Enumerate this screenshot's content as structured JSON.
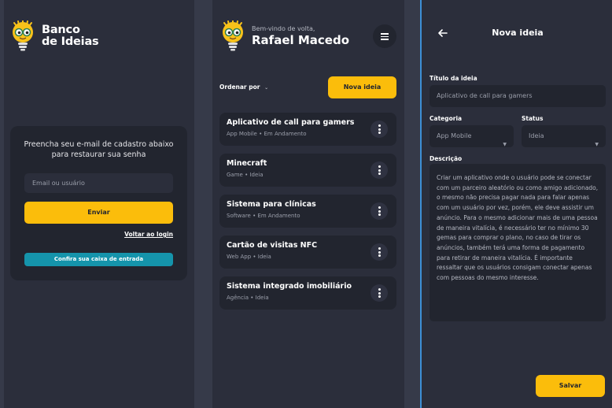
{
  "colors": {
    "background": "#363a49",
    "panel": "#2b2e3b",
    "card": "#22252f",
    "accent": "#fbbd0b",
    "teal": "#1594ab",
    "divider": "#3d8fd6"
  },
  "brand": {
    "line1": "Banco",
    "line2": "de Ideias",
    "logo_icon": "lightbulb-mascot-icon"
  },
  "recover": {
    "message": "Preencha seu e-mail de cadastro abaixo para restaurar sua senha",
    "email_placeholder": "Email ou usuário",
    "send_label": "Enviar",
    "back_to_login": "Voltar ao login",
    "check_inbox": "Confira sua caixa de entrada"
  },
  "home": {
    "welcome": "Bem-vindo de volta,",
    "username": "Rafael Macedo",
    "sort_label": "Ordenar por",
    "new_idea": "Nova ideia",
    "ideas": [
      {
        "title": "Aplicativo de call para gamers",
        "category": "App Mobile",
        "status": "Em Andamento"
      },
      {
        "title": "Minecraft",
        "category": "Game",
        "status": "Ideia"
      },
      {
        "title": "Sistema para clínicas",
        "category": "Software",
        "status": "Em Andamento"
      },
      {
        "title": "Cartão de visitas NFC",
        "category": "Web App",
        "status": "Ideia"
      },
      {
        "title": "Sistema integrado imobiliário",
        "category": "Agência",
        "status": "Ideia"
      }
    ],
    "separator": "•"
  },
  "form": {
    "header": "Nova ideia",
    "title_label": "Título da ideia",
    "title_value": "Aplicativo de call para gamers",
    "category_label": "Categoria",
    "category_value": "App Mobile",
    "status_label": "Status",
    "status_value": "Ideia",
    "description_label": "Descrição",
    "description_value": "Criar um aplicativo onde o usuário pode se conectar com um parceiro aleatório ou como amigo adicionado, o mesmo não precisa pagar nada para falar apenas com um usuário por vez, porém, ele deve assistir um anúncio. Para o mesmo adicionar mais de uma pessoa de maneira vitalícia, é necessário ter no mínimo 30 gemas para comprar o plano, no caso de tirar os anúncios, também terá uma forma de pagamento para retirar de maneira vitalícia. É importante ressaltar que os usuários consigam conectar apenas com pessoas do mesmo interesse.",
    "save_label": "Salvar"
  }
}
